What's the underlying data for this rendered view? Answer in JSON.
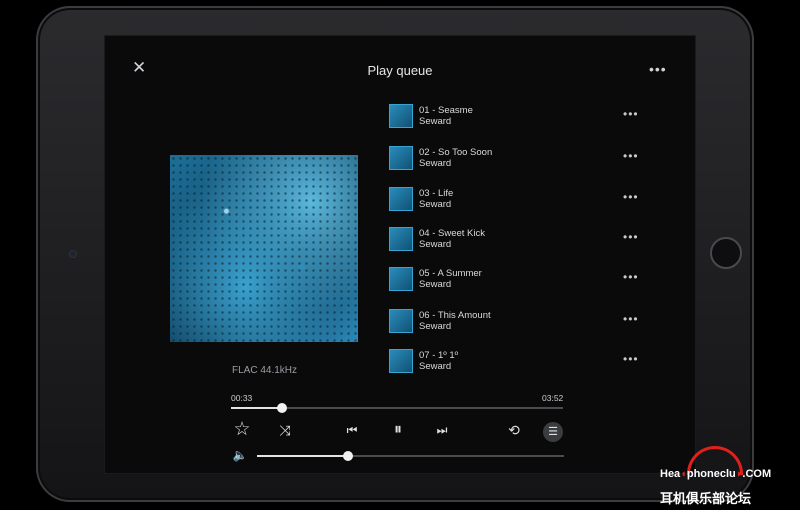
{
  "header": {
    "title": "Play queue",
    "close_icon": "close-icon",
    "more_icon": "more-horizontal-icon"
  },
  "now_playing": {
    "format": "FLAC 44.1kHz",
    "elapsed": "00:33",
    "duration": "03:52",
    "progress_fraction": 0.155,
    "volume_fraction": 0.295
  },
  "queue": [
    {
      "title": "01 - Seasme",
      "artist": "Seward"
    },
    {
      "title": "02 - So Too Soon",
      "artist": "Seward"
    },
    {
      "title": "03 - Life",
      "artist": "Seward"
    },
    {
      "title": "04 - Sweet Kick",
      "artist": "Seward"
    },
    {
      "title": "05 - A Summer",
      "artist": "Seward"
    },
    {
      "title": "06 - This Amount",
      "artist": "Seward"
    },
    {
      "title": "07 - 1º 1º",
      "artist": "Seward"
    }
  ],
  "controls": {
    "favorite": "☆",
    "shuffle": "⤨",
    "previous": "⏮",
    "play_pause": "⏸",
    "next": "⏭",
    "repeat": "⟲",
    "queue": "☰",
    "volume": "🔈"
  },
  "watermark": {
    "brand_a": "Hea",
    "brand_b": "phoneclu",
    "brand_c": ".COM",
    "brand_cn": "耳机俱乐部论坛"
  },
  "colors": {
    "background": "#0a0a0b",
    "accent": "#e0201b"
  }
}
